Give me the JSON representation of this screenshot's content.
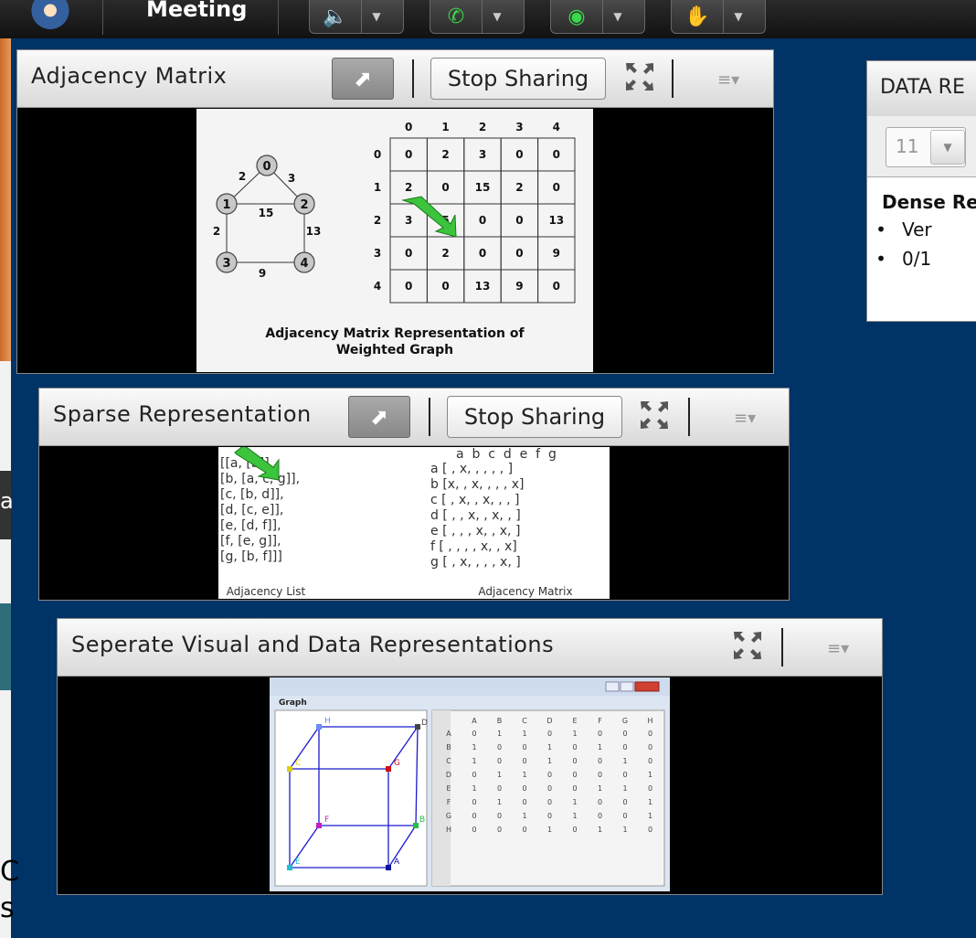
{
  "topbar": {
    "title": "Meeting",
    "buttons": [
      {
        "name": "audio",
        "icon": "speaker-icon"
      },
      {
        "name": "phone",
        "icon": "phone-icon"
      },
      {
        "name": "webcam",
        "icon": "webcam-icon"
      },
      {
        "name": "raise-hand",
        "icon": "raise-hand-icon"
      }
    ]
  },
  "pods": {
    "adjacency": {
      "title": "Adjacency Matrix",
      "stop_label": "Stop Sharing",
      "graph": {
        "nodes": [
          "0",
          "1",
          "2",
          "3",
          "4"
        ],
        "edge_weights": [
          "2",
          "3",
          "15",
          "2",
          "13",
          "9"
        ]
      },
      "matrix": {
        "headers": [
          "0",
          "1",
          "2",
          "3",
          "4"
        ],
        "rows": [
          [
            "0",
            "2",
            "3",
            "0",
            "0"
          ],
          [
            "2",
            "0",
            "15",
            "2",
            "0"
          ],
          [
            "3",
            "5",
            "0",
            "0",
            "13"
          ],
          [
            "0",
            "2",
            "0",
            "0",
            "9"
          ],
          [
            "0",
            "0",
            "13",
            "9",
            "0"
          ]
        ]
      },
      "caption_line1": "Adjacency Matrix Representation of",
      "caption_line2": "Weighted Graph"
    },
    "sparse": {
      "title": "Sparse Representation",
      "stop_label": "Stop Sharing",
      "adjacency_list": [
        "[[a, [b]],",
        " [b, [a, c, g]],",
        " [c, [b, d]],",
        " [d, [c, e]],",
        " [e, [d, f]],",
        " [f, [e, g]],",
        " [g, [b, f]]]"
      ],
      "list_caption": "Adjacency List",
      "matrix_header": "a  b  c  d  e  f  g",
      "matrix_rows": [
        "a [ , x,  ,  ,  ,  ,  ]",
        "b [x,  , x,  ,  ,  , x]",
        "c [ , x,  , x,  ,  ,  ]",
        "d [ ,  , x,  , x,  ,  ]",
        "e [ ,  ,  , x,  , x,  ]",
        "f [ ,  ,  ,  , x,  , x]",
        "g [ , x,  ,  ,  , x,  ]"
      ],
      "matrix_caption": "Adjacency Matrix"
    },
    "separate": {
      "title": "Seperate Visual and Data Representations",
      "window_menu": "Graph",
      "cube_labels": [
        "H",
        "D",
        "G",
        "C",
        "F",
        "B",
        "E",
        "A"
      ],
      "table": {
        "headers": [
          "A",
          "B",
          "C",
          "D",
          "E",
          "F",
          "G",
          "H"
        ],
        "rows": [
          [
            "A",
            "0",
            "1",
            "1",
            "0",
            "1",
            "0",
            "0",
            "0"
          ],
          [
            "B",
            "1",
            "0",
            "0",
            "1",
            "0",
            "1",
            "0",
            "0"
          ],
          [
            "C",
            "1",
            "0",
            "0",
            "1",
            "0",
            "0",
            "1",
            "0"
          ],
          [
            "D",
            "0",
            "1",
            "1",
            "0",
            "0",
            "0",
            "0",
            "1"
          ],
          [
            "E",
            "1",
            "0",
            "0",
            "0",
            "0",
            "1",
            "1",
            "0"
          ],
          [
            "F",
            "0",
            "1",
            "0",
            "0",
            "1",
            "0",
            "0",
            "1"
          ],
          [
            "G",
            "0",
            "0",
            "1",
            "0",
            "1",
            "0",
            "0",
            "1"
          ],
          [
            "H",
            "0",
            "0",
            "0",
            "1",
            "0",
            "1",
            "1",
            "0"
          ]
        ]
      }
    }
  },
  "data_panel": {
    "title": "DATA RE",
    "font_size": "11",
    "heading": "Dense Rep",
    "bullets": [
      "Ver",
      "0/1"
    ]
  },
  "left_strip": {
    "text1": "a",
    "text2": "C",
    "text3": "s"
  }
}
